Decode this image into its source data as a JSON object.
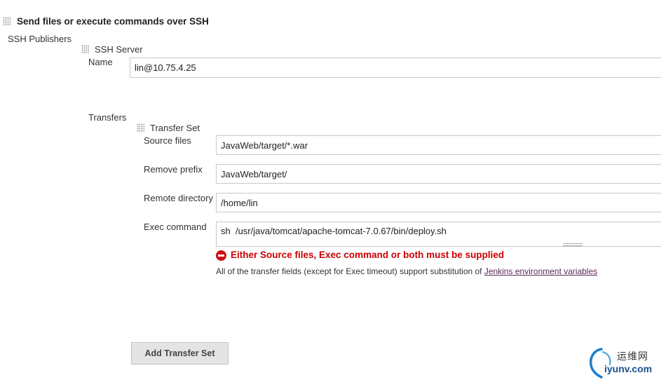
{
  "section": {
    "title": "Send files or execute commands over SSH"
  },
  "publishers": {
    "label": "SSH Publishers",
    "server": {
      "title": "SSH Server",
      "name_label": "Name",
      "name_value": "lin@10.75.4.25",
      "transfers_label": "Transfers",
      "transfer_set": {
        "title": "Transfer Set",
        "source_files_label": "Source files",
        "source_files_value": "JavaWeb/target/*.war",
        "remove_prefix_label": "Remove prefix",
        "remove_prefix_value": "JavaWeb/target/",
        "remote_directory_label": "Remote directory",
        "remote_directory_value": "/home/lin",
        "exec_command_label": "Exec command",
        "exec_command_value": "sh  /usr/java/tomcat/apache-tomcat-7.0.67/bin/deploy.sh",
        "error_message": "Either Source files, Exec command or both must be supplied",
        "help_text": "All of the transfer fields (except for Exec timeout) support substitution of ",
        "help_link": "Jenkins environment variables"
      },
      "add_transfer_set_label": "Add Transfer Set"
    }
  },
  "watermark": {
    "cn": "运维网",
    "en": "iyunv.com"
  },
  "colors": {
    "error": "#cc0000",
    "link": "#5a2a5a",
    "logo_blue": "#1a7fd0"
  }
}
